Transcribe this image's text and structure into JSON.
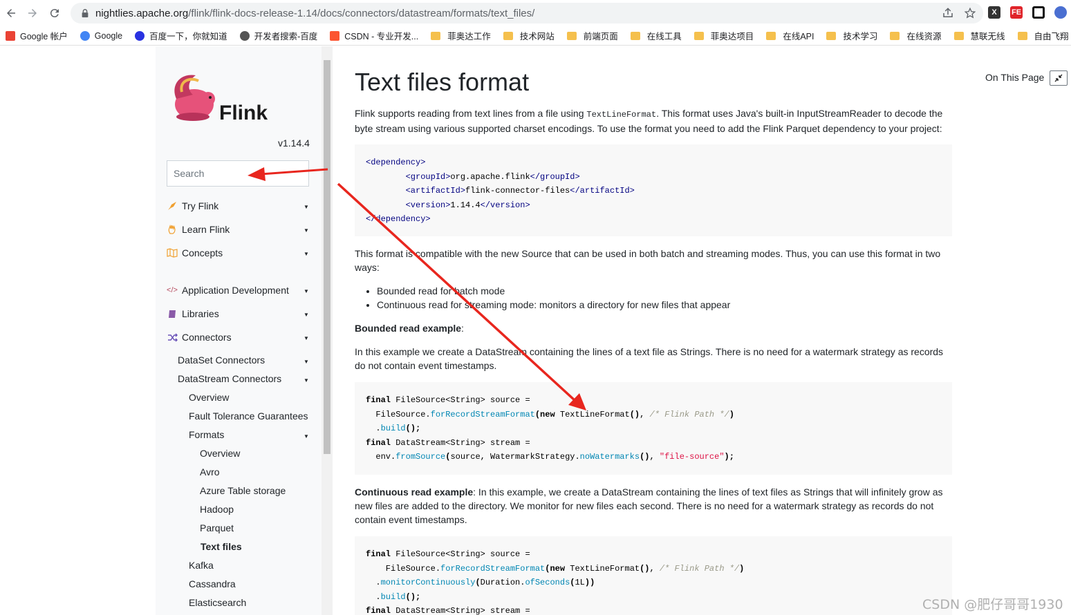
{
  "browser": {
    "url_host": "nightlies.apache.org",
    "url_path": "/flink/flink-docs-release-1.14/docs/connectors/datastream/formats/text_files/",
    "bookmarks": [
      {
        "label": "Google 帐户",
        "color": "#ea4335"
      },
      {
        "label": "Google",
        "color": "#4285f4"
      },
      {
        "label": "百度一下，你就知道",
        "color": "#2932e1"
      },
      {
        "label": "开发者搜索-百度",
        "color": "#555555"
      },
      {
        "label": "CSDN - 专业开发...",
        "color": "#fc5531"
      },
      {
        "label": "菲奥达工作",
        "color": "folder"
      },
      {
        "label": "技术网站",
        "color": "folder"
      },
      {
        "label": "前端页面",
        "color": "folder"
      },
      {
        "label": "在线工具",
        "color": "folder"
      },
      {
        "label": "菲奥达项目",
        "color": "folder"
      },
      {
        "label": "在线API",
        "color": "folder"
      },
      {
        "label": "技术学习",
        "color": "folder"
      },
      {
        "label": "在线资源",
        "color": "folder"
      },
      {
        "label": "慧联无线",
        "color": "folder"
      },
      {
        "label": "自由飞翔",
        "color": "folder"
      }
    ]
  },
  "sidebar": {
    "logo_text": "Flink",
    "version": "v1.14.4",
    "search_placeholder": "Search",
    "items": [
      {
        "label": "Try Flink",
        "icon": "rocket-icon"
      },
      {
        "label": "Learn Flink",
        "icon": "hand-icon"
      },
      {
        "label": "Concepts",
        "icon": "map-icon"
      },
      {
        "label": "Application Development",
        "icon": "code-icon"
      },
      {
        "label": "Libraries",
        "icon": "book-icon"
      },
      {
        "label": "Connectors",
        "icon": "shuffle-icon"
      }
    ],
    "connectors_sub": {
      "dataset": "DataSet Connectors",
      "datastream": "DataStream Connectors",
      "overview": "Overview",
      "fault_tolerance": "Fault Tolerance Guarantees",
      "formats": "Formats",
      "formats_children": [
        "Overview",
        "Avro",
        "Azure Table storage",
        "Hadoop",
        "Parquet",
        "Text files"
      ],
      "kafka": "Kafka",
      "cassandra": "Cassandra",
      "elasticsearch": "Elasticsearch"
    }
  },
  "content": {
    "title": "Text files format",
    "on_this_page": "On This Page",
    "intro_1": "Flink supports reading from text lines from a file using ",
    "intro_code": "TextLineFormat",
    "intro_2": ". This format uses Java's built-in InputStreamReader to decode the byte stream using various supported charset encodings. To use the format you need to add the Flink Parquet dependency to your project:",
    "dependency": {
      "open": "<dependency>",
      "group_open": "<groupId>",
      "group": "org.apache.flink",
      "group_close": "</groupId>",
      "artifact_open": "<artifactId>",
      "artifact": "flink-connector-files",
      "artifact_close": "</artifactId>",
      "version_open": "<version>",
      "version": "1.14.4",
      "version_close": "</version>",
      "close": "</dependency>"
    },
    "compat": "This format is compatible with the new Source that can be used in both batch and streaming modes. Thus, you can use this format in two ways:",
    "bullets": [
      "Bounded read for batch mode",
      "Continuous read for streaming mode: monitors a directory for new files that appear"
    ],
    "bounded_heading": "Bounded read example",
    "bounded_colon": ":",
    "bounded_text": "In this example we create a DataStream containing the lines of a text file as Strings. There is no need for a watermark strategy as records do not contain event timestamps.",
    "continuous_heading": "Continuous read example",
    "continuous_text": ": In this example, we create a DataStream containing the lines of text files as Strings that will infinitely grow as new files are added to the directory. We monitor for new files each second. There is no need for a watermark strategy as records do not contain event timestamps."
  },
  "watermark": "CSDN @肥仔哥哥1930",
  "annotation_color": "#e8261e"
}
